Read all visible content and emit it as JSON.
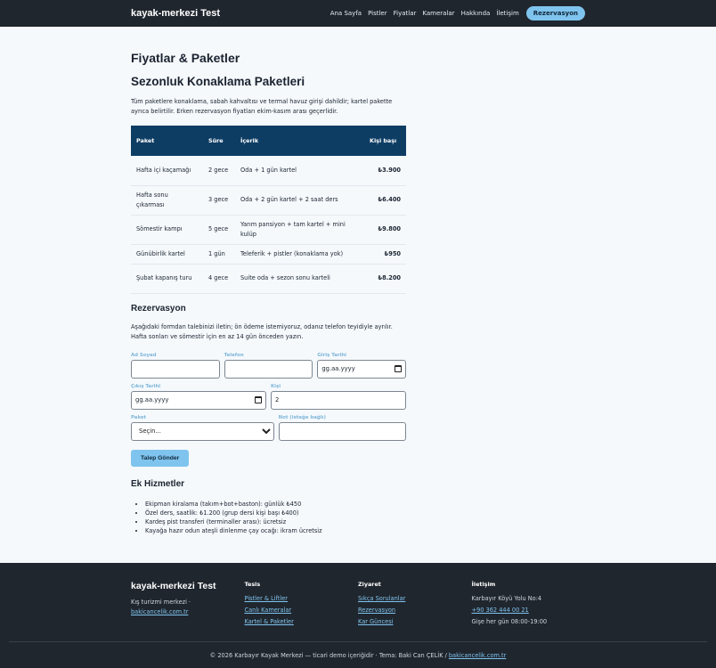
{
  "header": {
    "brand": "kayak-merkezi Test",
    "nav": [
      "Ana Sayfa",
      "Pistler",
      "Fiyatlar",
      "Kameralar",
      "Hakkında",
      "İletişim"
    ],
    "cta": "Rezervasyon"
  },
  "page": {
    "title": "Fiyatlar & Paketler",
    "subtitle": "Sezonluk Konaklama Paketleri",
    "lead": "Tüm paketlere konaklama, sabah kahvaltısı ve termal havuz girişi dahildir; kartel pakette ayrıca belirtilir. Erken rezervasyon fiyatları ekim-kasım arası geçerlidir."
  },
  "table": {
    "headers": [
      "Paket",
      "Süre",
      "İçerik",
      "Kişi başı"
    ],
    "rows": [
      [
        "Hafta içi kaçamağı",
        "2 gece",
        "Oda + 1 gün kartel",
        "₺3.900"
      ],
      [
        "Hafta sonu çıkarması",
        "3 gece",
        "Oda + 2 gün kartel + 2 saat ders",
        "₺6.400"
      ],
      [
        "Sömestir kampı",
        "5 gece",
        "Yarım pansiyon + tam kartel + mini kulüp",
        "₺9.800"
      ],
      [
        "Günübirlik kartel",
        "1 gün",
        "Teleferik + pistler (konaklama yok)",
        "₺950"
      ],
      [
        "Şubat kapanış turu",
        "4 gece",
        "Suite oda + sezon sonu karteli",
        "₺8.200"
      ]
    ]
  },
  "reservation": {
    "title": "Rezervasyon",
    "desc": "Aşağıdaki formdan talebinizi iletin; ön ödeme istemiyoruz, odanız telefon teyidiyle ayrılır. Hafta sonları ve sömestir için en az 14 gün önceden yazın.",
    "labels": {
      "name": "Ad Soyad",
      "phone": "Telefon",
      "checkin": "Giriş Tarihi",
      "checkout": "Çıkış Tarihi",
      "people": "Kişi",
      "package": "Paket",
      "note": "Not (isteğe bağlı)"
    },
    "values": {
      "name": "",
      "phone": "",
      "checkin": "gg.aa.yyyy",
      "checkout": "gg.aa.yyyy",
      "people": "2",
      "package": "Seçin...",
      "note": ""
    },
    "submit": "Talep Gönder"
  },
  "extras": {
    "title": "Ek Hizmetler",
    "items": [
      "Ekipman kiralama (takım+bot+baston): günlük ₺450",
      "Özel ders, saatlik: ₺1.200 (grup dersi kişi başı ₺400)",
      "Kardeş pist transferi (terminaller arası): ücretsiz",
      "Kayağa hazır odun ateşli dinlenme çay ocağı: ikram ücretsiz"
    ]
  },
  "footer": {
    "brand": "kayak-merkezi Test",
    "tagline": "Kış turizmi merkezi ·",
    "tagline_link": "bakicancelik.com.tr",
    "cols": [
      {
        "title": "Tesis",
        "links": [
          "Pistler & Liftler",
          "Canlı Kameralar",
          "Kartel & Paketler"
        ]
      },
      {
        "title": "Ziyaret",
        "links": [
          "Sıkça Sorulanlar",
          "Rezervasyon",
          "Kar Güncesi"
        ]
      }
    ],
    "contact": {
      "title": "İletişim",
      "address": "Karbayır Köyü Yolu No:4",
      "phone": "+90 362 444 00 21",
      "hours": "Gişe her gün 08:00-19:00"
    },
    "copyright": "© 2026 Karbayır Kayak Merkezi — ticari demo içeriğidir · Tema: Baki Can ÇELİK /",
    "copyright_link": "bakicancelik.com.tr"
  }
}
